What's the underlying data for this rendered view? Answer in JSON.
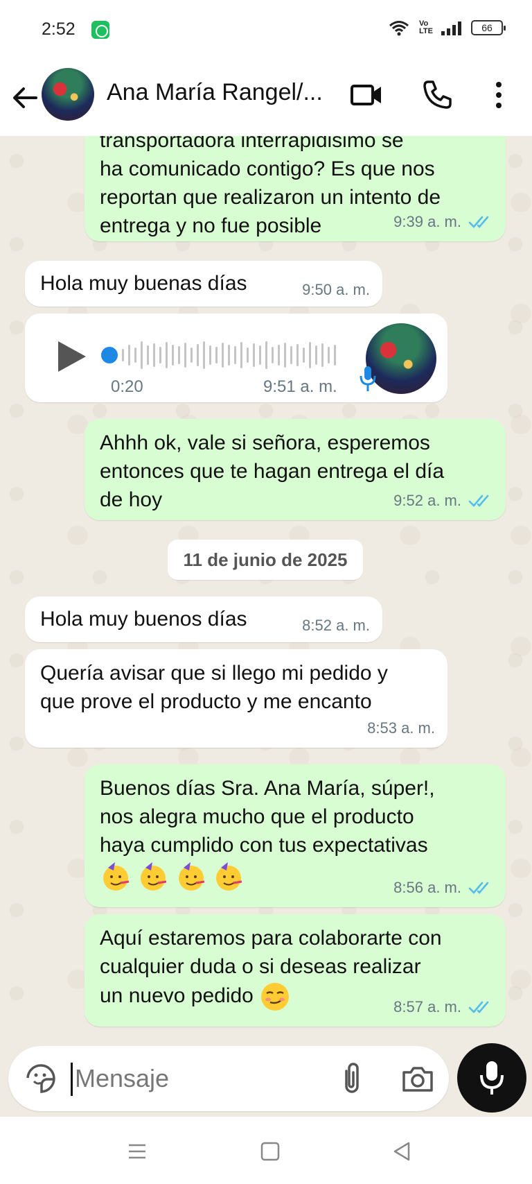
{
  "status_bar": {
    "time": "2:52",
    "volte": "Vo LTE",
    "battery": "66"
  },
  "header": {
    "contact_name": "Ana María Rangel/...",
    "icons": [
      "back-arrow-icon",
      "video-call-icon",
      "phone-icon",
      "more-options-icon"
    ]
  },
  "messages": [
    {
      "direction": "outgoing",
      "lines": [
        "transportadora interrapidisimo se",
        "ha comunicado contigo? Es que nos",
        "reportan que realizaron un intento de",
        "entrega y no fue posible"
      ],
      "time": "9:39 a. m.",
      "read": true
    },
    {
      "direction": "incoming",
      "text": "Hola muy buenas días",
      "time": "9:50 a. m."
    },
    {
      "direction": "incoming",
      "type": "voice",
      "duration": "0:20",
      "time": "9:51 a. m."
    },
    {
      "direction": "outgoing",
      "lines": [
        "Ahhh ok, vale si señora, esperemos",
        "entonces que te hagan entrega el día",
        "de hoy"
      ],
      "time": "9:52 a. m.",
      "read": true
    }
  ],
  "date_separator": "11 de junio de 2025",
  "messages_after": [
    {
      "direction": "incoming",
      "text": "Hola muy buenos días",
      "time": "8:52 a. m."
    },
    {
      "direction": "incoming",
      "lines": [
        "Quería avisar que si llego mi pedido y",
        "que prove el producto y me encanto"
      ],
      "time": "8:53 a. m."
    },
    {
      "direction": "outgoing",
      "lines": [
        "Buenos días Sra. Ana María, súper!,",
        "nos alegra mucho que el producto",
        "haya cumplido con tus expectativas"
      ],
      "emojis": [
        "partying-face-emoji",
        "partying-face-emoji",
        "partying-face-emoji",
        "partying-face-emoji"
      ],
      "time": "8:56 a. m.",
      "read": true
    },
    {
      "direction": "outgoing",
      "lines": [
        "Aquí estaremos para colaborarte con",
        "cualquier duda o si deseas realizar",
        "un nuevo pedido"
      ],
      "emojis": [
        "smirking-face-emoji"
      ],
      "time": "8:57 a. m.",
      "read": true
    }
  ],
  "composer": {
    "placeholder": "Mensaje"
  },
  "colors": {
    "outgoing_bubble": "#d9fdd3",
    "incoming_bubble": "#ffffff",
    "chat_background": "#efeae2",
    "read_tick": "#53bdeb",
    "voice_accent": "#1e88e5"
  }
}
